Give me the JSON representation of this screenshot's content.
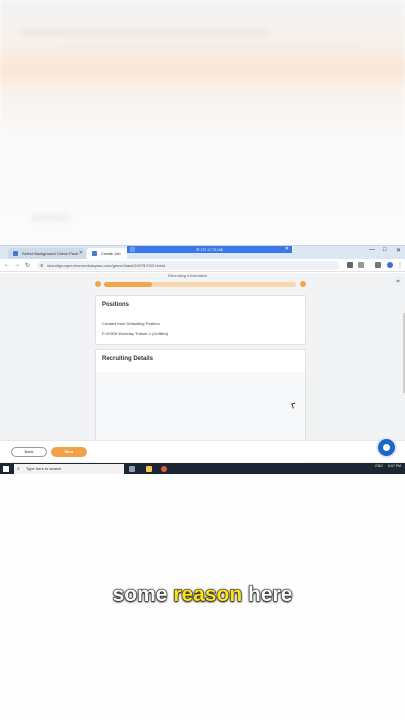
{
  "browser": {
    "tabs": [
      {
        "label": "Select Background Check Pack"
      },
      {
        "label": "Create Job"
      }
    ],
    "overlay_bar_text": "☰ 172.17.72.108",
    "url": "shandigroupreview.workdayasu.com/genx/d/task/2997$7000.htmld",
    "window_controls": [
      "—",
      "□",
      "✕"
    ]
  },
  "page": {
    "breadcrumb": "Recruiting Information",
    "progress_fraction": 0.25,
    "positions_card": {
      "title": "Positions",
      "field_label": "Created from Defaulting Position",
      "field_value": "P-00909 Workday Trainer-1 (Unfilled)"
    },
    "recruiting_card": {
      "title": "Recruiting Details"
    },
    "back_label": "Back",
    "next_label": "Next"
  },
  "taskbar": {
    "search_placeholder": "Type here to search",
    "tray_time": "6:07 PM",
    "tray_lang": "ENG"
  },
  "caption": {
    "words": [
      "some",
      "reason",
      "here"
    ]
  },
  "colors": {
    "accent_orange": "#f0a24a",
    "help_blue": "#1f65c8",
    "caption_highlight": "#ffe31a"
  }
}
